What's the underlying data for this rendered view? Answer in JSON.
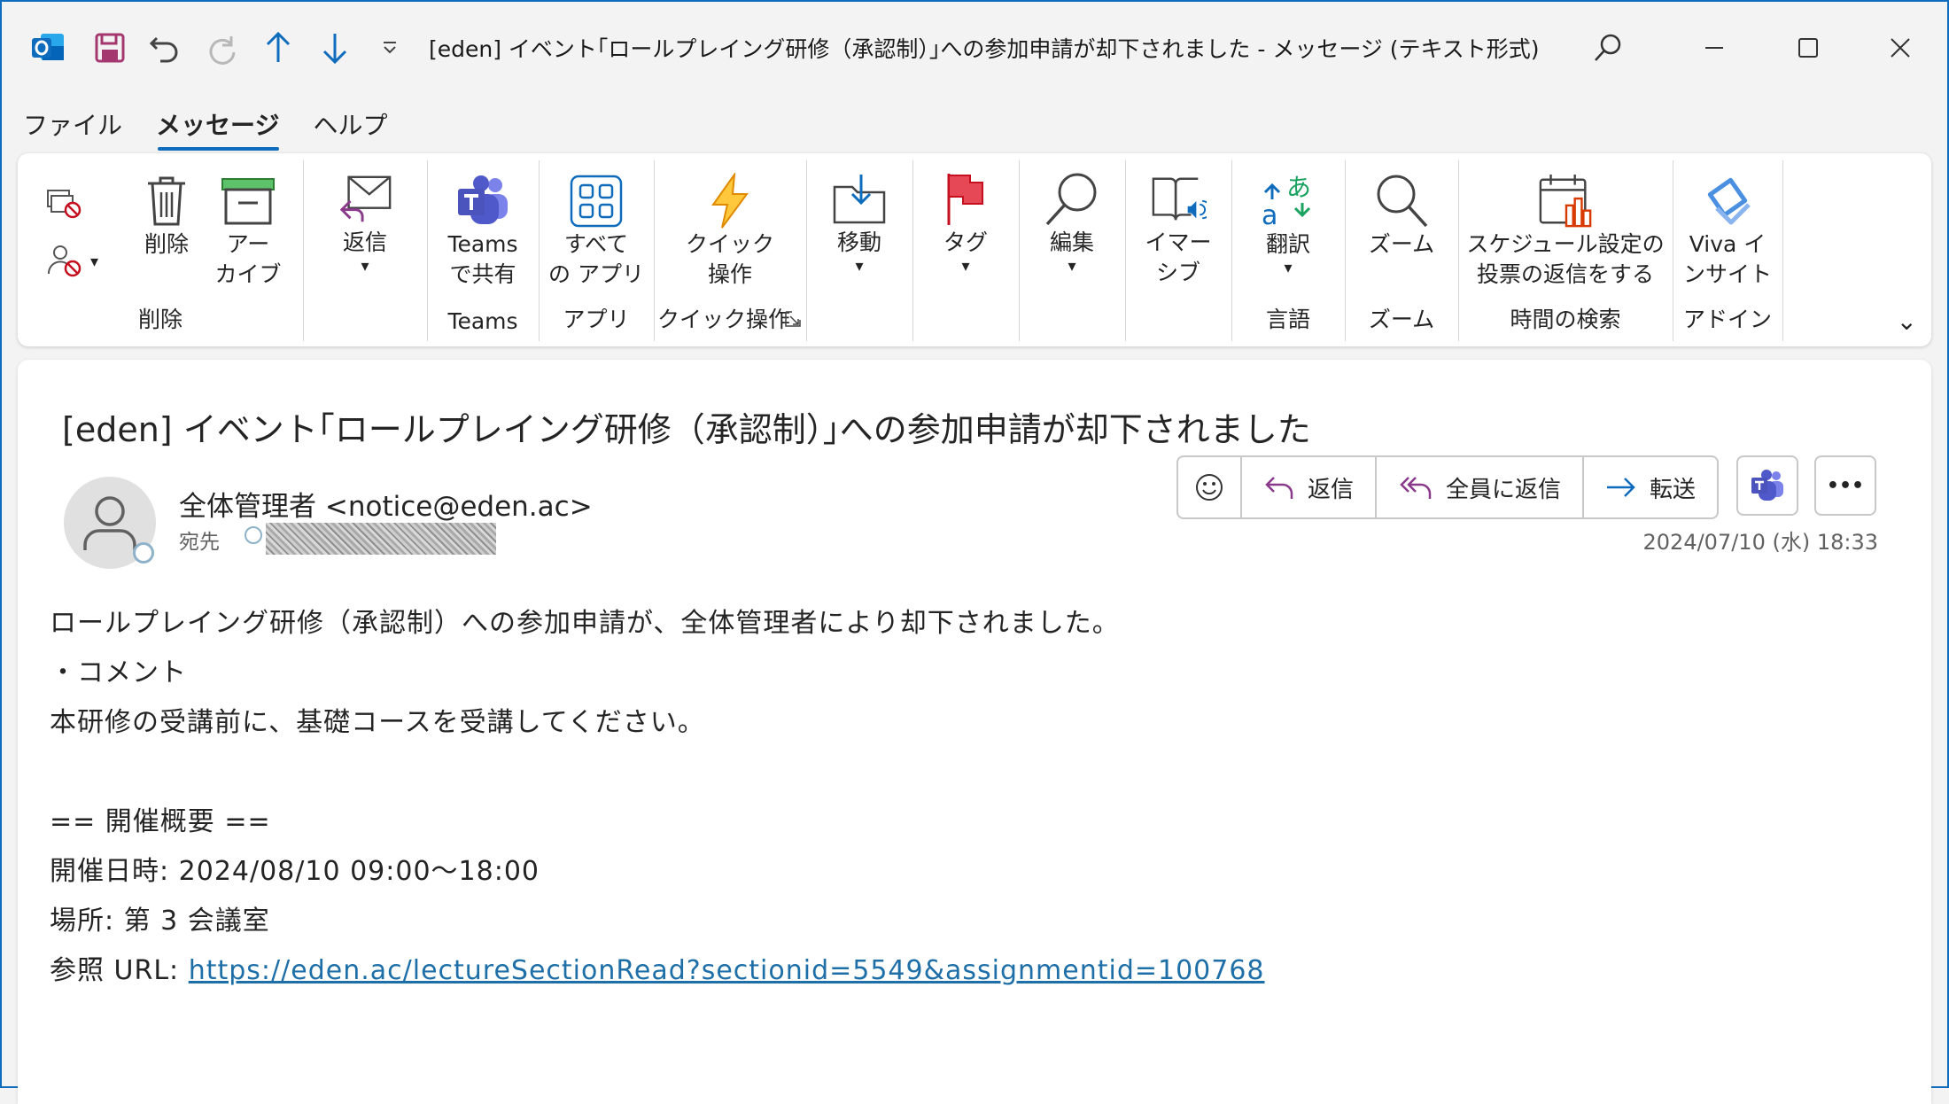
{
  "titlebar": {
    "title": "[eden] イベント｢ロールプレイング研修（承認制）｣への参加申請が却下されました  -  メッセージ (テキスト形式)",
    "icons": [
      "outlook-icon",
      "save-icon",
      "undo-icon",
      "redo-icon",
      "up-arrow-icon",
      "down-arrow-icon",
      "customize-icon"
    ],
    "controls": [
      "search-icon",
      "minimize-icon",
      "maximize-icon",
      "close-icon"
    ]
  },
  "menu": {
    "tabs": [
      {
        "label": "ファイル",
        "active": false
      },
      {
        "label": "メッセージ",
        "active": true
      },
      {
        "label": "ヘルプ",
        "active": false
      }
    ]
  },
  "ribbon": {
    "groups": {
      "delete": {
        "label": "削除",
        "delete_btn": "削除",
        "archive_btn": "アー\nカイブ"
      },
      "reply": {
        "reply_btn": "返信"
      },
      "teams": {
        "label": "Teams",
        "share_btn": "Teams\nで共有"
      },
      "apps": {
        "label": "アプリ",
        "all_apps_btn": "すべて\nの アプリ"
      },
      "quick": {
        "label": "クイック操作",
        "quick_btn": "クイック\n操作"
      },
      "move": {
        "move_btn": "移動"
      },
      "tags": {
        "tag_btn": "タグ"
      },
      "edit": {
        "edit_btn": "編集"
      },
      "immersive": {
        "immersive_btn": "イマー\nシブ"
      },
      "language": {
        "label": "言語",
        "translate_btn": "翻訳"
      },
      "zoom": {
        "label": "ズーム",
        "zoom_btn": "ズーム"
      },
      "time": {
        "label": "時間の検索",
        "schedule_btn": "スケジュール設定の\n投票の返信をする"
      },
      "addin": {
        "label": "アドイン",
        "viva_btn": "Viva イ\nンサイト"
      }
    },
    "chevron": "▾",
    "collapse": "⌄"
  },
  "message": {
    "subject": "[eden] イベント｢ロールプレイング研修（承認制）｣への参加申請が却下されました",
    "sender": "全体管理者 <notice@eden.ac>",
    "to_label": "宛先",
    "date": "2024/07/10 (水) 18:33",
    "actions": {
      "reply": "返信",
      "reply_all": "全員に返信",
      "forward": "転送",
      "more": "•••"
    },
    "body": [
      "ロールプレイング研修（承認制）への参加申請が、全体管理者により却下されました。",
      "・コメント",
      "本研修の受講前に、基礎コースを受講してください。",
      "",
      "== 開催概要 ==",
      "開催日時: 2024/08/10 09:00〜18:00",
      "場所: 第 3 会議室"
    ],
    "url_prefix": "参照 URL: ",
    "url": "https://eden.ac/lectureSectionRead?sectionid=5549&assignmentid=100768"
  }
}
